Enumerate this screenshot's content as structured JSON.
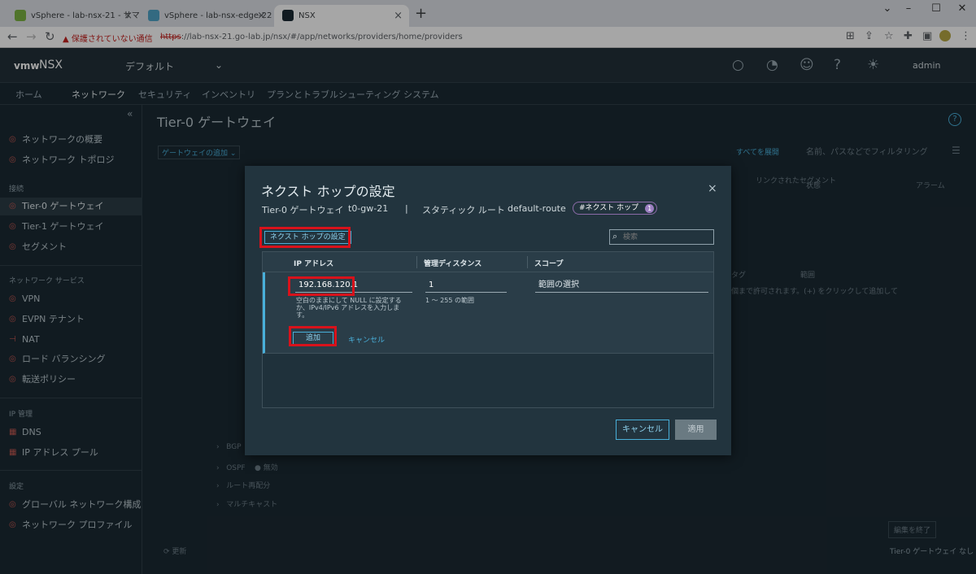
{
  "browser": {
    "tabs": [
      {
        "title": "vSphere - lab-nsx-21 - サマリ"
      },
      {
        "title": "vSphere - lab-nsx-edge-22 - サマ"
      },
      {
        "title": "NSX"
      }
    ],
    "security_warning": "保護されていない通信",
    "url_scheme": "https",
    "url_rest": "://lab-nsx-21.go-lab.jp/nsx/#/app/networks/providers/home/providers"
  },
  "header": {
    "logo": "vmw",
    "product": "NSX",
    "tenant": "デフォルト",
    "user": "admin"
  },
  "nav": [
    "ホーム",
    "ネットワーク",
    "セキュリティ",
    "インベントリ",
    "プランとトラブルシューティング",
    "システム"
  ],
  "sidebar": {
    "items_top": [
      "ネットワークの概要",
      "ネットワーク トポロジ"
    ],
    "section_connect": "接続",
    "items_connect": [
      "Tier-0 ゲートウェイ",
      "Tier-1 ゲートウェイ",
      "セグメント"
    ],
    "section_services": "ネットワーク サービス",
    "items_services": [
      "VPN",
      "EVPN テナント",
      "NAT",
      "ロード バランシング",
      "転送ポリシー"
    ],
    "section_ip": "IP 管理",
    "items_ip": [
      "DNS",
      "IP アドレス プール"
    ],
    "section_settings": "設定",
    "items_settings": [
      "グローバル ネットワーク構成",
      "ネットワーク プロファイル"
    ]
  },
  "main": {
    "title": "Tier-0 ゲートウェイ",
    "add_gateway": "ゲートウェイの追加",
    "expand_all": "すべてを展開",
    "filter_placeholder": "名前、パスなどでフィルタリング",
    "col_linked_segments": "リンクされたセグメント",
    "col_status": "状態",
    "col_alarm": "アラーム",
    "tag_label": "タグ",
    "scope_label": "範囲",
    "tag_hint": "個まで許可されます。(+) をクリックして追加して",
    "bgp": "BGP",
    "ospf": "OSPF",
    "ospf_status": "無効",
    "route_redist": "ルート再配分",
    "multicast": "マルチキャスト",
    "finish_edit": "編集を終了",
    "refresh": "更新",
    "footer_right": "Tier-0 ゲートウェイ なし"
  },
  "modal": {
    "title": "ネクスト ホップの設定",
    "bc_gateway_label": "Tier-0 ゲートウェイ",
    "bc_gateway": "t0-gw-21",
    "bc_sep": "|",
    "bc_route_label": "スタティック ルート",
    "bc_route": "default-route",
    "badge": "#ネクスト ホップ",
    "badge_count": "1",
    "set_button": "ネクスト ホップの設定",
    "search_placeholder": "検索",
    "columns": [
      "IP アドレス",
      "管理ディスタンス",
      "スコープ"
    ],
    "row": {
      "ip": "192.168.120.1",
      "ip_hint": "空白のままにして NULL に設定するか、IPv4/IPv6 アドレスを入力します。",
      "distance": "1",
      "distance_hint": "1 ～ 255 の範囲",
      "scope_placeholder": "範囲の選択"
    },
    "row_add": "追加",
    "row_cancel": "キャンセル",
    "cancel": "キャンセル",
    "apply": "適用"
  },
  "colors": {
    "accent": "#49afd9",
    "highlight": "#d8121b",
    "badge": "#9b7fc1"
  }
}
